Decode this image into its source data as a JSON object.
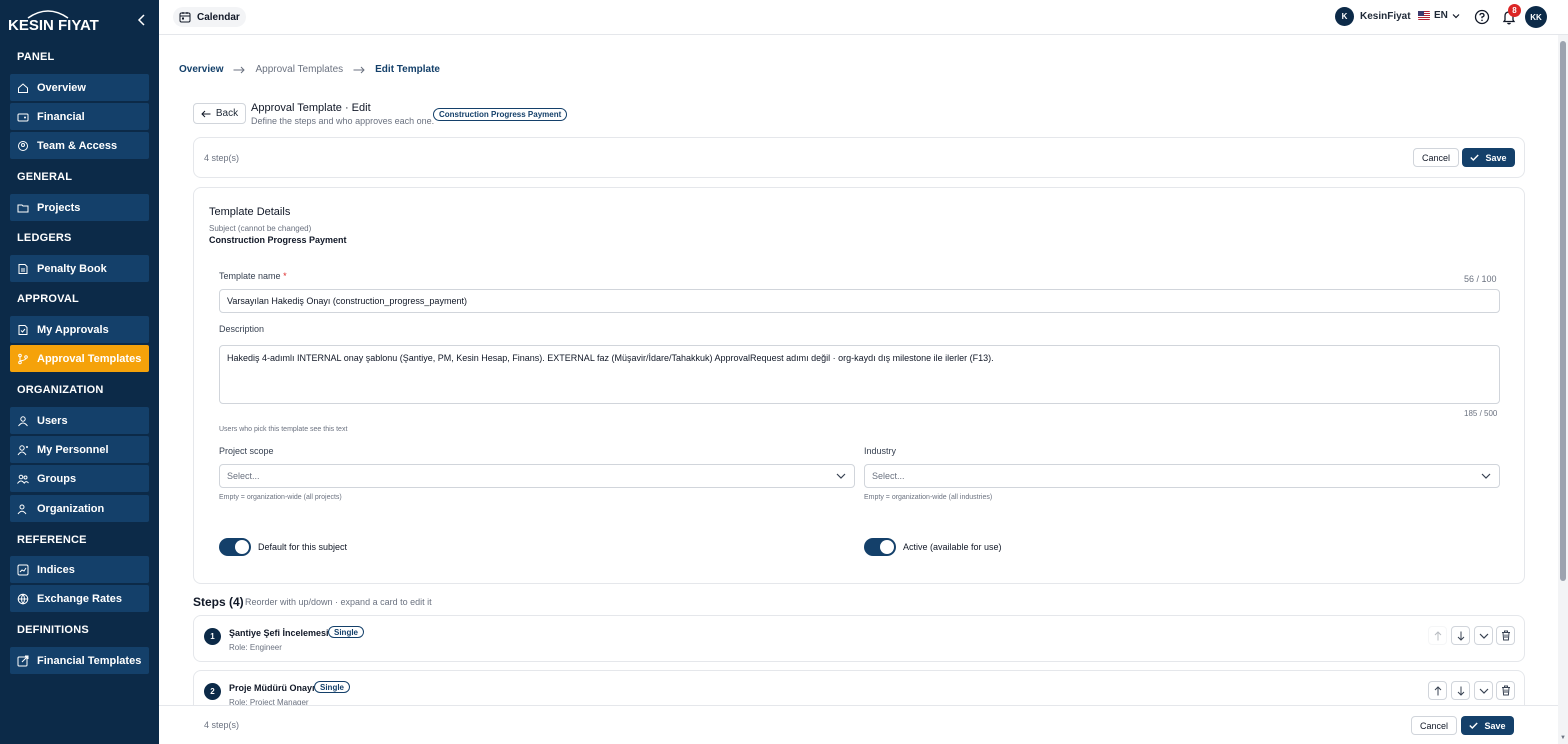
{
  "app": {
    "logo": "KESIN FIYAT"
  },
  "sidebar": {
    "sections": [
      {
        "label": "PANEL"
      },
      {
        "label": "GENERAL"
      },
      {
        "label": "LEDGERS"
      },
      {
        "label": "APPROVAL"
      },
      {
        "label": "ORGANIZATION"
      },
      {
        "label": "REFERENCE"
      },
      {
        "label": "DEFINITIONS"
      }
    ],
    "items": [
      {
        "label": "Overview",
        "icon": "home-icon"
      },
      {
        "label": "Financial",
        "icon": "wallet-icon"
      },
      {
        "label": "Team & Access",
        "icon": "team-icon"
      },
      {
        "label": "Projects",
        "icon": "folder-icon"
      },
      {
        "label": "Penalty Book",
        "icon": "book-icon"
      },
      {
        "label": "My Approvals",
        "icon": "approvals-icon"
      },
      {
        "label": "Approval Templates",
        "icon": "branch-icon",
        "active": true
      },
      {
        "label": "Users",
        "icon": "user-icon"
      },
      {
        "label": "My Personnel",
        "icon": "personnel-icon"
      },
      {
        "label": "Groups",
        "icon": "groups-icon"
      },
      {
        "label": "Organization",
        "icon": "org-icon"
      },
      {
        "label": "Indices",
        "icon": "chart-icon"
      },
      {
        "label": "Exchange Rates",
        "icon": "globe-icon"
      },
      {
        "label": "Financial Templates",
        "icon": "template-icon"
      }
    ]
  },
  "topbar": {
    "calendar_label": "Calendar",
    "user_initial": "K",
    "user_name": "KesinFiyat",
    "language": "EN",
    "notification_count": "8",
    "avatar_initials": "KK"
  },
  "breadcrumb": [
    "Overview",
    "Approval Templates",
    "Edit Template"
  ],
  "header": {
    "back_label": "Back",
    "title": "Approval Template · Edit",
    "subtitle": "Define the steps and who approves each one.",
    "subject_badge": "Construction Progress Payment"
  },
  "actions": {
    "step_count": "4 step(s)",
    "cancel_label": "Cancel",
    "save_label": "Save"
  },
  "details": {
    "title": "Template Details",
    "subject_label": "Subject (cannot be changed)",
    "subject_value": "Construction Progress Payment",
    "name_label": "Template name",
    "name_required": "*",
    "name_counter": "56 / 100",
    "name_value": "Varsayılan Hakediş Onayı (construction_progress_payment)",
    "description_label": "Description",
    "description_value": "Hakediş 4-adımlı INTERNAL onay şablonu (Şantiye, PM, Kesin Hesap, Finans). EXTERNAL faz (Müşavir/İdare/Tahakkuk) ApprovalRequest adımı değil · org-kaydı dış milestone ile ilerler (F13).",
    "description_counter": "185 / 500",
    "description_hint": "Users who pick this template see this text",
    "project_scope_label": "Project scope",
    "project_scope_placeholder": "Select...",
    "project_scope_hint": "Empty = organization-wide (all projects)",
    "industry_label": "Industry",
    "industry_placeholder": "Select...",
    "industry_hint": "Empty = organization-wide (all industries)",
    "default_label": "Default for this subject",
    "default_on": true,
    "active_label": "Active (available for use)",
    "active_on": true
  },
  "steps": {
    "title": "Steps (4)",
    "hint": "Reorder with up/down · expand a card to edit it",
    "items": [
      {
        "number": "1",
        "name": "Şantiye Şefi İncelemesi",
        "type": "Single",
        "role": "Role: Engineer"
      },
      {
        "number": "2",
        "name": "Proje Müdürü Onayı",
        "type": "Single",
        "role": "Role: Project Manager"
      }
    ]
  },
  "colors": {
    "sidebar": "#0c2a48",
    "nav_item": "#14406a",
    "active": "#f5a20a",
    "primary": "#14406a",
    "badge": "#dc2626"
  }
}
